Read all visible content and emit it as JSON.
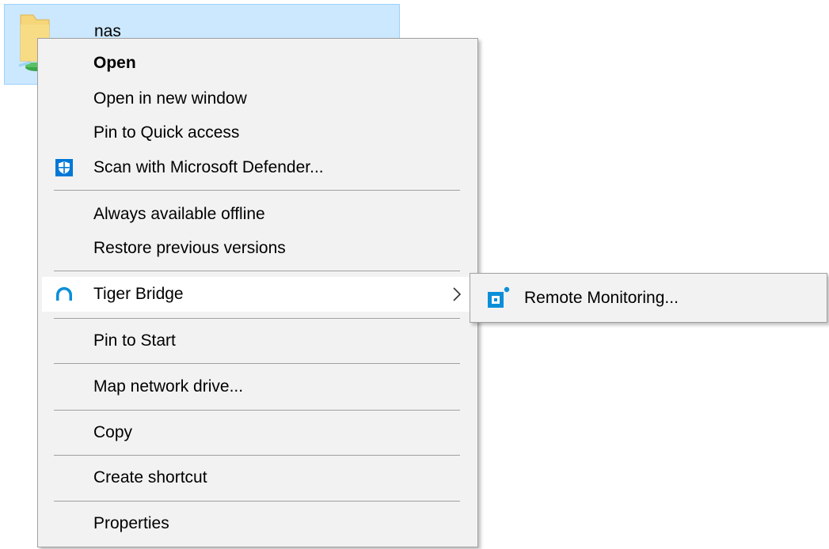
{
  "desktop_item": {
    "name": "nas"
  },
  "context_menu": {
    "items": [
      {
        "label": "Open"
      },
      {
        "label": "Open in new window"
      },
      {
        "label": "Pin to Quick access"
      },
      {
        "label": "Scan with Microsoft Defender..."
      },
      {
        "label": "Always available offline"
      },
      {
        "label": "Restore previous versions"
      },
      {
        "label": "Tiger Bridge"
      },
      {
        "label": "Pin to Start"
      },
      {
        "label": "Map network drive..."
      },
      {
        "label": "Copy"
      },
      {
        "label": "Create shortcut"
      },
      {
        "label": "Properties"
      }
    ]
  },
  "submenu": {
    "items": [
      {
        "label": "Remote Monitoring..."
      }
    ]
  },
  "icons": {
    "folder": "network-folder-icon",
    "defender": "shield-icon",
    "tiger_bridge": "tiger-bridge-icon",
    "submenu_arrow": "chevron-right-icon",
    "remote_monitoring": "remote-monitoring-icon"
  },
  "colors": {
    "selection_fill": "#cce8ff",
    "selection_border": "#99d1ff",
    "menu_background": "#f2f2f2",
    "menu_border": "#a0a0a0",
    "highlight": "#ffffff",
    "accent_blue": "#0078d7"
  }
}
